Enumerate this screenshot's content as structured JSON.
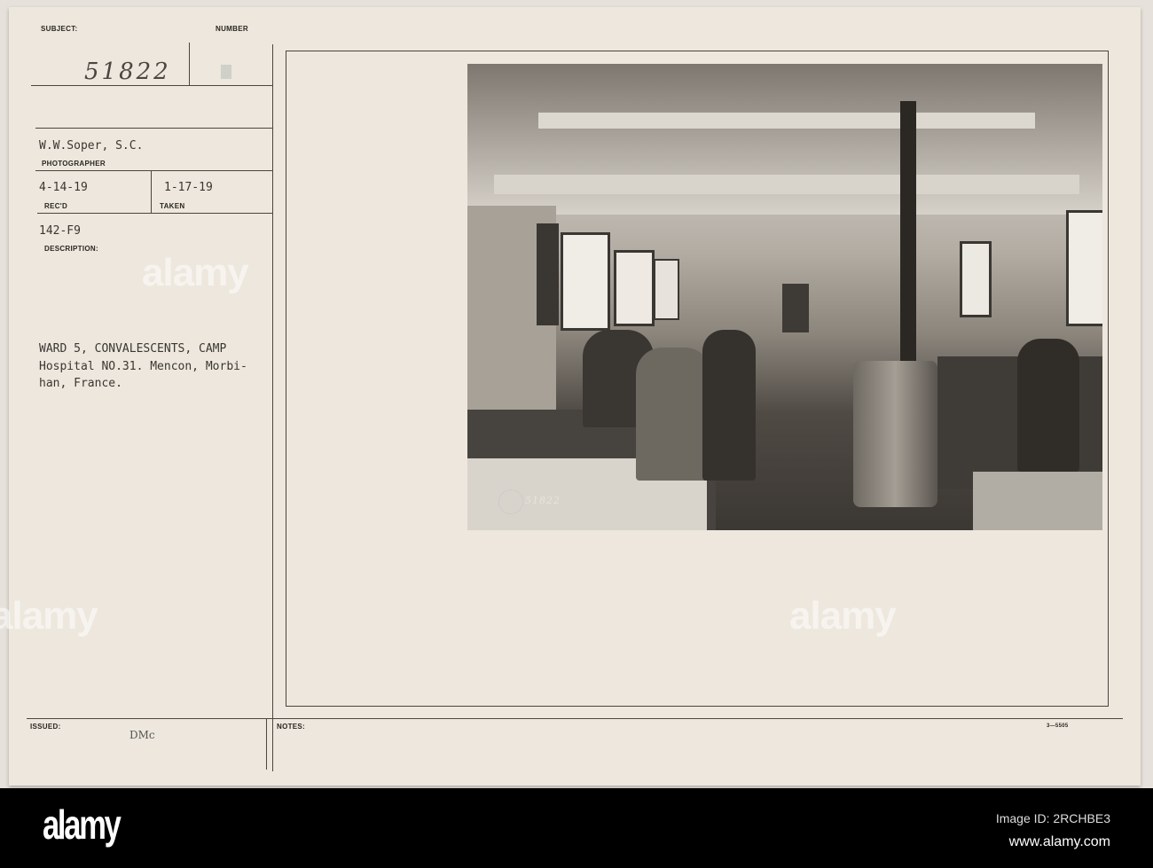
{
  "card": {
    "subject_label": "SUBJECT:",
    "subject_number": "51822",
    "number_label": "NUMBER",
    "photographer": "W.W.Soper, S.C.",
    "photographer_label": "PHOTOGRAPHER",
    "received": "4-14-19",
    "received_label": "REC'D",
    "taken": "1-17-19",
    "taken_label": "TAKEN",
    "code": "142-F9",
    "description_label": "DESCRIPTION:",
    "description_lines": [
      "WARD 5, CONVALESCENTS, CAMP",
      "Hospital NO.31. Mencon, Morbi-",
      "han, France."
    ],
    "issued_label": "ISSUED:",
    "issued_value": "DMc",
    "notes_label": "NOTES:",
    "form_number": "3—5505"
  },
  "photo": {
    "negative_number": "51822"
  },
  "footer": {
    "logo": "alamy",
    "image_id": "Image ID: 2RCHBE3",
    "url": "www.alamy.com"
  },
  "watermark": "alamy"
}
